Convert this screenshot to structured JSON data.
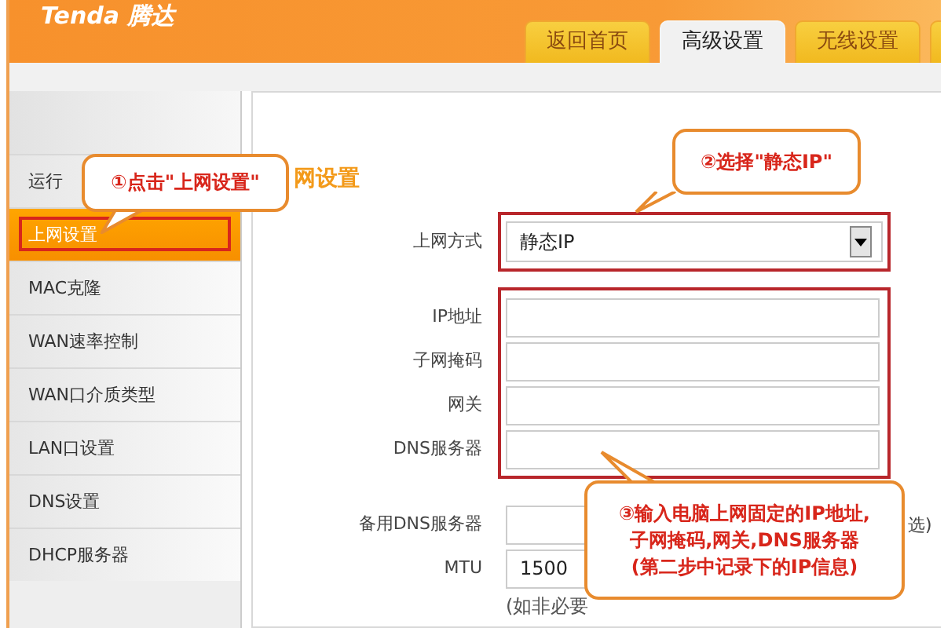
{
  "header": {
    "logo": "Tenda 腾达"
  },
  "tabs": [
    {
      "label": "返回首页",
      "selected": false
    },
    {
      "label": "高级设置",
      "selected": true
    },
    {
      "label": "无线设置",
      "selected": false
    }
  ],
  "sidebar": {
    "items": [
      {
        "label": "运行",
        "selected": false,
        "outlined": false
      },
      {
        "label": "上网设置",
        "selected": true,
        "outlined": true
      },
      {
        "label": "MAC克隆",
        "selected": false,
        "outlined": false
      },
      {
        "label": "WAN速率控制",
        "selected": false,
        "outlined": false
      },
      {
        "label": "WAN口介质类型",
        "selected": false,
        "outlined": false
      },
      {
        "label": "LAN口设置",
        "selected": false,
        "outlined": false
      },
      {
        "label": "DNS设置",
        "selected": false,
        "outlined": false
      },
      {
        "label": "DHCP服务器",
        "selected": false,
        "outlined": false
      }
    ]
  },
  "section": {
    "title": "网设置"
  },
  "form": {
    "groups": [
      {
        "outlined": true,
        "rows": [
          {
            "label": "上网方式",
            "kind": "select",
            "value": "静态IP"
          }
        ]
      },
      {
        "outlined": true,
        "rows": [
          {
            "label": "IP地址",
            "kind": "input"
          },
          {
            "label": "子网掩码",
            "kind": "input"
          },
          {
            "label": "网关",
            "kind": "input"
          },
          {
            "label": "DNS服务器",
            "kind": "input"
          }
        ]
      },
      {
        "rows": [
          {
            "label": "备用DNS服务器",
            "kind": "input",
            "suffix": "选)"
          },
          {
            "label": "MTU",
            "kind": "input",
            "value": "1500"
          }
        ],
        "note": "(如非必要"
      }
    ]
  },
  "annotations": [
    {
      "text": "①点击\"上网设置\""
    },
    {
      "text": "②选择\"静态IP\""
    },
    {
      "text": "③输入电脑上网固定的IP地址,\n子网掩码,网关,DNS服务器\n(第二步中记录下的IP信息)"
    }
  ]
}
